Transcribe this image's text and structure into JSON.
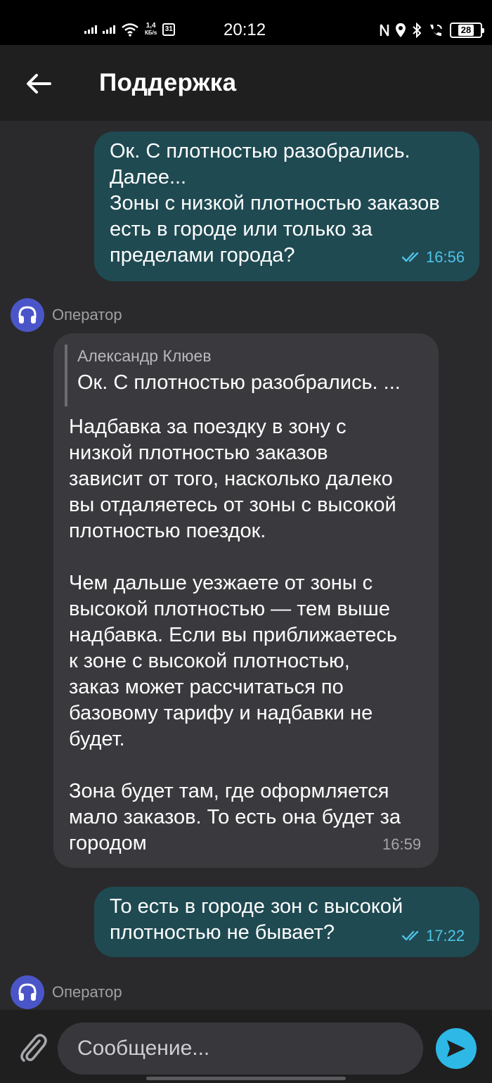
{
  "status_bar": {
    "time": "20:12",
    "net_speed_value": "1,4",
    "net_speed_unit": "КБ/s",
    "calendar_day": "31",
    "battery": "28"
  },
  "header": {
    "title": "Поддержка"
  },
  "messages": [
    {
      "direction": "out",
      "text": "Ок. С плотностью разобрались.\nДалее...\nЗоны с низкой плотностью заказов\nесть в городе или только за\nпределами города?",
      "time": "16:56",
      "status": "read"
    },
    {
      "direction": "in",
      "sender": "Оператор",
      "quote": {
        "author": "Александр Клюев",
        "text": "Ок. С плотностью разобрались. ..."
      },
      "text": "Надбавка за поездку в зону с\nнизкой плотностью заказов\nзависит от того, насколько далеко\nвы отдаляетесь от зоны с высокой\nплотностью поездок.\n\nЧем дальше уезжаете от зоны с\nвысокой плотностью — тем выше\nнадбавка. Если вы приближаетесь\nк зоне с высокой плотностью,\nзаказ может рассчитаться по\nбазовому тарифу и надбавки не\nбудет.\n\nЗона будет там, где оформляется\nмало заказов. То есть она будет за\nгородом",
      "time": "16:59"
    },
    {
      "direction": "out",
      "text": "То есть в городе зон с высокой\nплотностью не бывает?",
      "time": "17:22",
      "status": "read"
    },
    {
      "direction": "in",
      "sender": "Оператор"
    }
  ],
  "composer": {
    "placeholder": "Сообщение..."
  },
  "colors": {
    "outgoing_bubble": "#1f4a52",
    "incoming_bubble": "#3a3a3e",
    "accent": "#2eb8e6",
    "avatar": "#4a56c8"
  }
}
